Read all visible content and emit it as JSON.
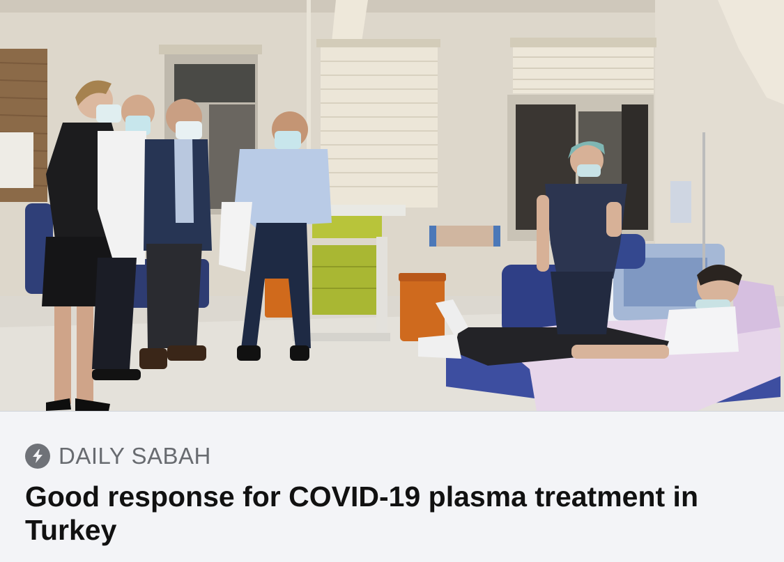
{
  "link_card": {
    "image": {
      "alt": "",
      "scene": "hospital-plasma-treatment-room"
    },
    "source": {
      "icon": "lightning-bolt-icon",
      "name": "DAILY SABAH"
    },
    "headline": "Good response for COVID-19 plasma treatment in Turkey"
  },
  "colors": {
    "card_background": "#f3f4f7",
    "source_text": "#686b70",
    "source_icon_bg": "#6f7278",
    "headline_text": "#111111"
  }
}
